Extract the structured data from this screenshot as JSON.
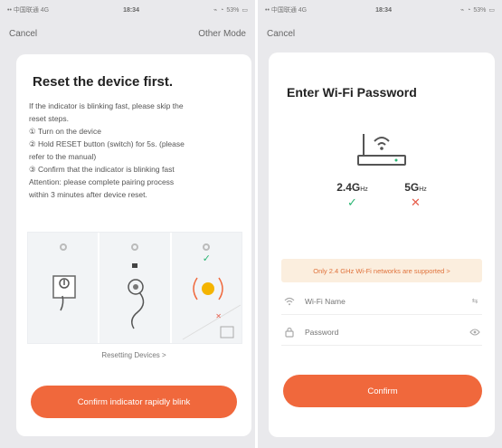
{
  "left": {
    "statusbar": {
      "carrier": "•• 中国联通 4G",
      "time": "18:34",
      "battery": "53%"
    },
    "navbar": {
      "cancel": "Cancel",
      "other_mode": "Other Mode"
    },
    "title": "Reset the device first.",
    "instructions": [
      "If the indicator is blinking fast, please skip the",
      "reset steps.",
      "① Turn on the device",
      "② Hold RESET button (switch) for 5s. (please",
      "refer to the manual)",
      "③ Confirm that the indicator is blinking fast",
      "Attention: please complete pairing process",
      "within 3 minutes after device reset."
    ],
    "illustration": {
      "panel3_mark": "✓",
      "panel3_error": "✕"
    },
    "link": "Resetting Devices >",
    "button": "Confirm indicator rapidly blink"
  },
  "right": {
    "statusbar": {
      "carrier": "•• 中国联通 4G",
      "time": "18:34",
      "battery": "53%"
    },
    "navbar": {
      "cancel": "Cancel"
    },
    "title": "Enter Wi-Fi Password",
    "bands": [
      {
        "label": "2.4G",
        "unit": "Hz",
        "mark": "✓"
      },
      {
        "label": "5G",
        "unit": "Hz",
        "mark": "✕"
      }
    ],
    "notice": "Only 2.4 GHz Wi-Fi networks are supported >",
    "wifi_field": {
      "placeholder": "Wi-Fi Name",
      "end": "⇆"
    },
    "password_field": {
      "placeholder": "Password"
    },
    "button": "Confirm"
  },
  "colors": {
    "accent": "#f0683c",
    "success": "#2bb673",
    "error": "#e65c4a",
    "notice_bg": "#fbeede"
  }
}
